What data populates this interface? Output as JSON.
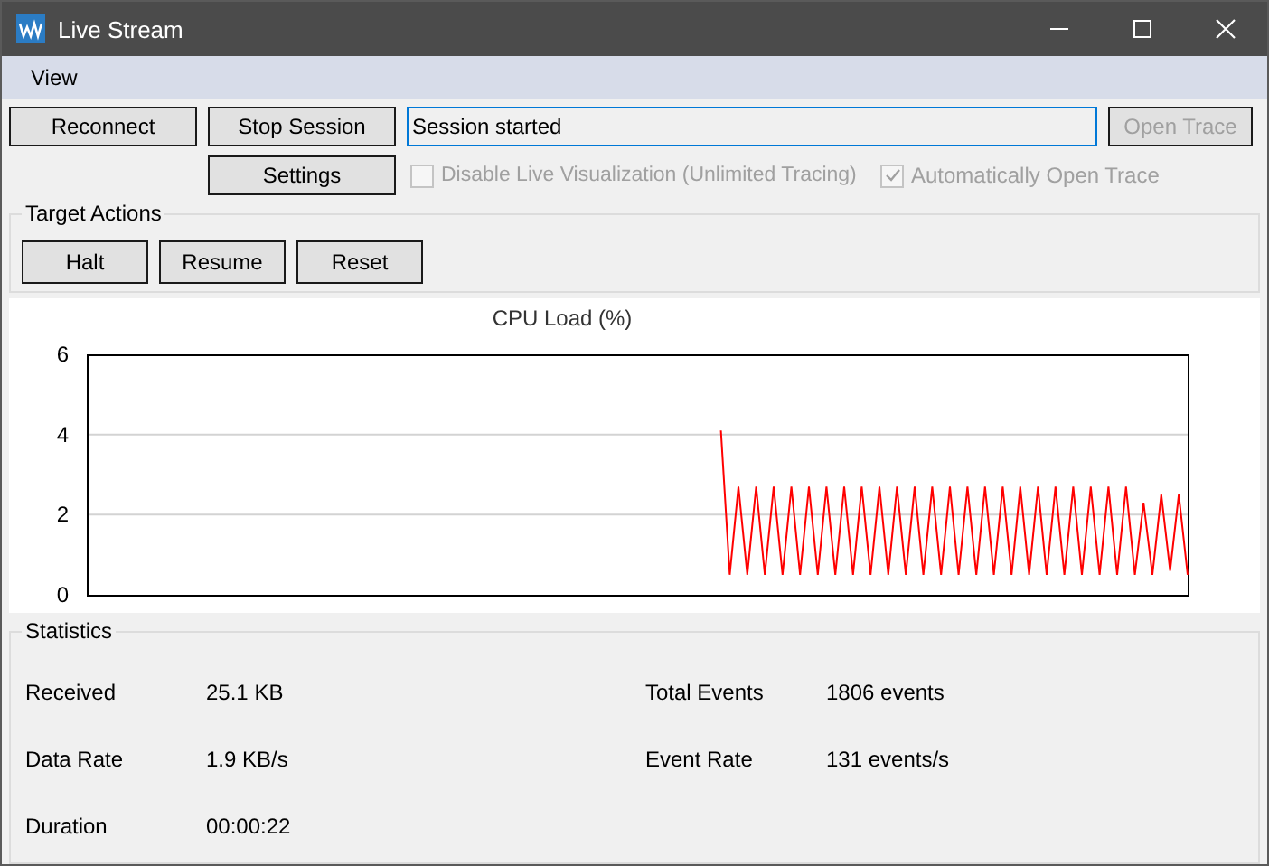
{
  "window": {
    "title": "Live Stream"
  },
  "menu": [
    {
      "label": "View"
    }
  ],
  "toolbar": {
    "buttons": [
      {
        "label": "Reconnect",
        "disabled": false
      },
      {
        "label": "Stop Session",
        "disabled": false
      }
    ],
    "status_field": {
      "value": "Session started"
    },
    "open_trace": {
      "label": "Open Trace",
      "disabled": true
    },
    "settings": {
      "label": "Settings",
      "disabled": false
    },
    "checkboxes": [
      {
        "label": "Disable Live Visualization (Unlimited Tracing)",
        "checked": false,
        "disabled": true
      },
      {
        "label": "Automatically Open Trace",
        "checked": true,
        "disabled": true
      }
    ]
  },
  "target_actions": {
    "title": "Target Actions",
    "buttons": [
      {
        "label": "Halt"
      },
      {
        "label": "Resume"
      },
      {
        "label": "Reset"
      }
    ]
  },
  "chart": {
    "chart_data": {
      "type": "line",
      "title": "CPU Load (%)",
      "ylim": [
        0,
        6
      ],
      "yticks": [
        0,
        2,
        4,
        6
      ],
      "categories": [
        null,
        null,
        null,
        null,
        null,
        null,
        null,
        null,
        null,
        null,
        null,
        null,
        null,
        null,
        null,
        null,
        null,
        null,
        null,
        null,
        null,
        null,
        null,
        null,
        null,
        null,
        null,
        null,
        null,
        null,
        null,
        null,
        null,
        null,
        null,
        null,
        null,
        null,
        null,
        null,
        null,
        null,
        null,
        null,
        null,
        null,
        null,
        null,
        null,
        null,
        null,
        null,
        null,
        null,
        null,
        null,
        null,
        null,
        null,
        null,
        null,
        null,
        null,
        null,
        null,
        null,
        null,
        null,
        null,
        null,
        null,
        null,
        null,
        null,
        null,
        null,
        null,
        null,
        null,
        null,
        null,
        null,
        null,
        null,
        null,
        null,
        null,
        null,
        null,
        null,
        null,
        null,
        null,
        null,
        null,
        null,
        null,
        null,
        null,
        null,
        null,
        null,
        null,
        null,
        null,
        null,
        null,
        null,
        null,
        null,
        null,
        null,
        null,
        null,
        null,
        null,
        null,
        null,
        null,
        null,
        null,
        null,
        null,
        null,
        null,
        null
      ],
      "series": [
        {
          "color": "#ff0000",
          "values": [
            null,
            null,
            null,
            null,
            null,
            null,
            null,
            null,
            null,
            null,
            null,
            null,
            null,
            null,
            null,
            null,
            null,
            null,
            null,
            null,
            null,
            null,
            null,
            null,
            null,
            null,
            null,
            null,
            null,
            null,
            null,
            null,
            null,
            null,
            null,
            null,
            null,
            null,
            null,
            null,
            null,
            null,
            null,
            null,
            null,
            null,
            null,
            null,
            null,
            null,
            null,
            null,
            null,
            null,
            null,
            null,
            null,
            null,
            null,
            null,
            null,
            null,
            null,
            null,
            null,
            null,
            null,
            null,
            null,
            null,
            null,
            null,
            4.1,
            0.5,
            2.7,
            0.5,
            2.7,
            0.5,
            2.7,
            0.5,
            2.7,
            0.5,
            2.7,
            0.5,
            2.7,
            0.5,
            2.7,
            0.5,
            2.7,
            0.5,
            2.7,
            0.5,
            2.7,
            0.5,
            2.7,
            0.5,
            2.7,
            0.5,
            2.7,
            0.5,
            2.7,
            0.5,
            2.7,
            0.5,
            2.7,
            0.5,
            2.7,
            0.5,
            2.7,
            0.5,
            2.7,
            0.5,
            2.7,
            0.5,
            2.7,
            0.5,
            2.7,
            0.5,
            2.7,
            0.5,
            2.3,
            0.5,
            2.5,
            0.6,
            2.5,
            0.5
          ]
        }
      ]
    }
  },
  "statistics": {
    "title": "Statistics",
    "items": [
      {
        "label": "Received",
        "value": "25.1 KB"
      },
      {
        "label": "Total Events",
        "value": "1806 events"
      },
      {
        "label": "Data Rate",
        "value": "1.9 KB/s"
      },
      {
        "label": "Event Rate",
        "value": "131 events/s"
      },
      {
        "label": "Duration",
        "value": "00:00:22"
      }
    ]
  }
}
